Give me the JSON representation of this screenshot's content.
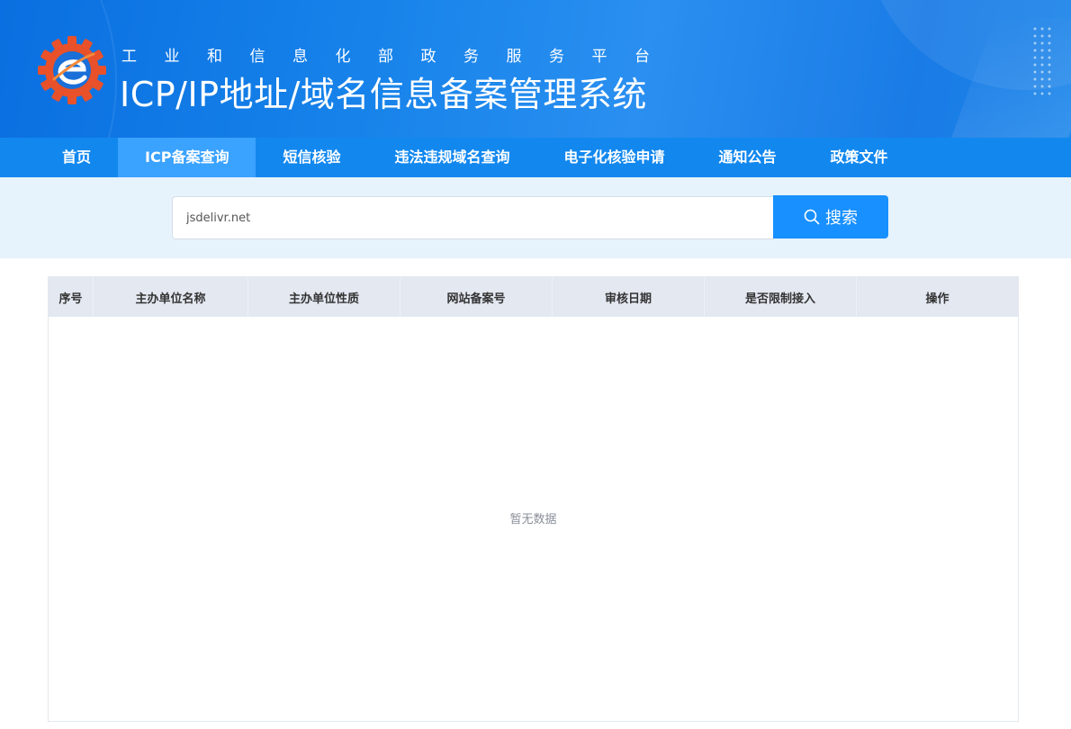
{
  "header": {
    "subtitle": "工业和信息化部政务服务平台",
    "title": "ICP/IP地址/域名信息备案管理系统"
  },
  "nav": {
    "items": [
      {
        "label": "首页",
        "active": false
      },
      {
        "label": "ICP备案查询",
        "active": true
      },
      {
        "label": "短信核验",
        "active": false
      },
      {
        "label": "违法违规域名查询",
        "active": false
      },
      {
        "label": "电子化核验申请",
        "active": false
      },
      {
        "label": "通知公告",
        "active": false
      },
      {
        "label": "政策文件",
        "active": false
      }
    ]
  },
  "search": {
    "value": "jsdelivr.net",
    "button_label": "搜索"
  },
  "table": {
    "columns": [
      "序号",
      "主办单位名称",
      "主办单位性质",
      "网站备案号",
      "审核日期",
      "是否限制接入",
      "操作"
    ],
    "empty_text": "暂无数据"
  },
  "colors": {
    "header_blue": "#1783ea",
    "nav_blue": "#1288ef",
    "nav_active": "#3aa2ff",
    "button_blue": "#1890ff",
    "logo_orange": "#e8512a"
  }
}
